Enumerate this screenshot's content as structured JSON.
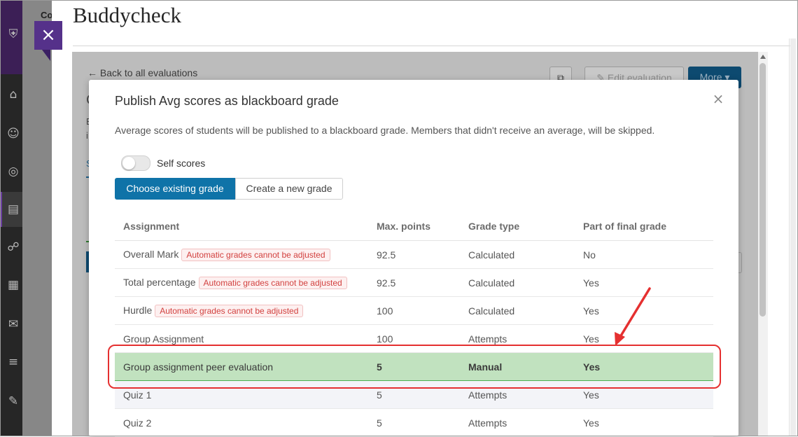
{
  "backdrop": {
    "top_text": "Co"
  },
  "panel": {
    "title": "Buddycheck"
  },
  "frame": {
    "back_link": "← Back to all evaluations",
    "edit_button": "✎ Edit evaluation",
    "more_button": "More ▾"
  },
  "modal": {
    "title": "Publish Avg scores as blackboard grade",
    "description": "Average scores of students will be published to a blackboard grade. Members that didn't receive an average, will be skipped.",
    "self_scores_label": "Self scores",
    "self_scores_on": false,
    "choose_existing_label": "Choose existing grade",
    "create_new_label": "Create a new grade",
    "table": {
      "headers": [
        "Assignment",
        "Max. points",
        "Grade type",
        "Part of final grade"
      ],
      "rows": [
        {
          "assignment": "Overall Mark",
          "badge": "Automatic grades cannot be adjusted",
          "max": "92.5",
          "type": "Calculated",
          "final": "No"
        },
        {
          "assignment": "Total percentage",
          "badge": "Automatic grades cannot be adjusted",
          "max": "92.5",
          "type": "Calculated",
          "final": "Yes"
        },
        {
          "assignment": "Hurdle",
          "badge": "Automatic grades cannot be adjusted",
          "max": "100",
          "type": "Calculated",
          "final": "Yes"
        },
        {
          "assignment": "Group Assignment",
          "badge": "",
          "max": "100",
          "type": "Attempts",
          "final": "Yes"
        },
        {
          "assignment": "Group assignment peer evaluation",
          "badge": "",
          "max": "5",
          "type": "Manual",
          "final": "Yes"
        },
        {
          "assignment": "Quiz 1",
          "badge": "",
          "max": "5",
          "type": "Attempts",
          "final": "Yes"
        },
        {
          "assignment": "Quiz 2",
          "badge": "",
          "max": "5",
          "type": "Attempts",
          "final": "Yes"
        }
      ]
    }
  },
  "icons": {
    "close_tab": "close-icon",
    "modal_close": "close-icon",
    "nav": [
      "institution-icon",
      "user-icon",
      "globe-icon",
      "courses-icon",
      "groups-icon",
      "calendar-icon",
      "messages-icon",
      "grades-icon",
      "tools-icon"
    ]
  },
  "colors": {
    "primary": "#0f73a8",
    "highlight_row": "#c1e2bf",
    "yes": "#2e8a2e",
    "no": "#c23030",
    "annotation": "#e53030",
    "purple": "#55318a"
  }
}
